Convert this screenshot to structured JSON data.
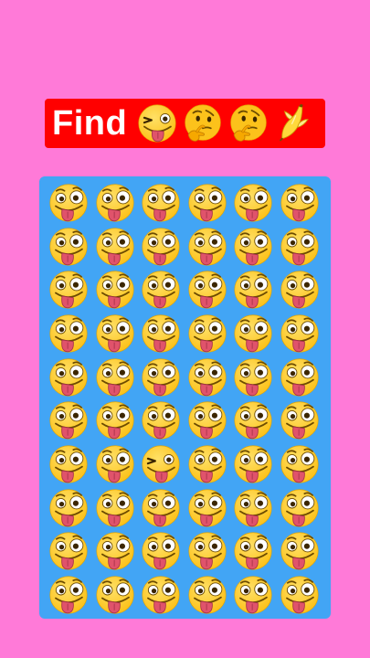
{
  "banner": {
    "title": "Find",
    "clues": [
      {
        "icon": "winking-face-with-tongue-icon"
      },
      {
        "icon": "thinking-face-icon"
      },
      {
        "icon": "thinking-face-icon"
      },
      {
        "icon": "banana-icon"
      }
    ]
  },
  "colors": {
    "background": "#ff7ad8",
    "banner": "#ff0000",
    "board": "#42a5f5",
    "face": "#fcc21b",
    "tongue": "#e0536b"
  },
  "puzzle": {
    "rows": 10,
    "columns": 6,
    "default_icon": "zany-face-icon",
    "odd_icon": "winking-face-with-tongue-icon",
    "odd_row": 7,
    "odd_column": 3
  }
}
